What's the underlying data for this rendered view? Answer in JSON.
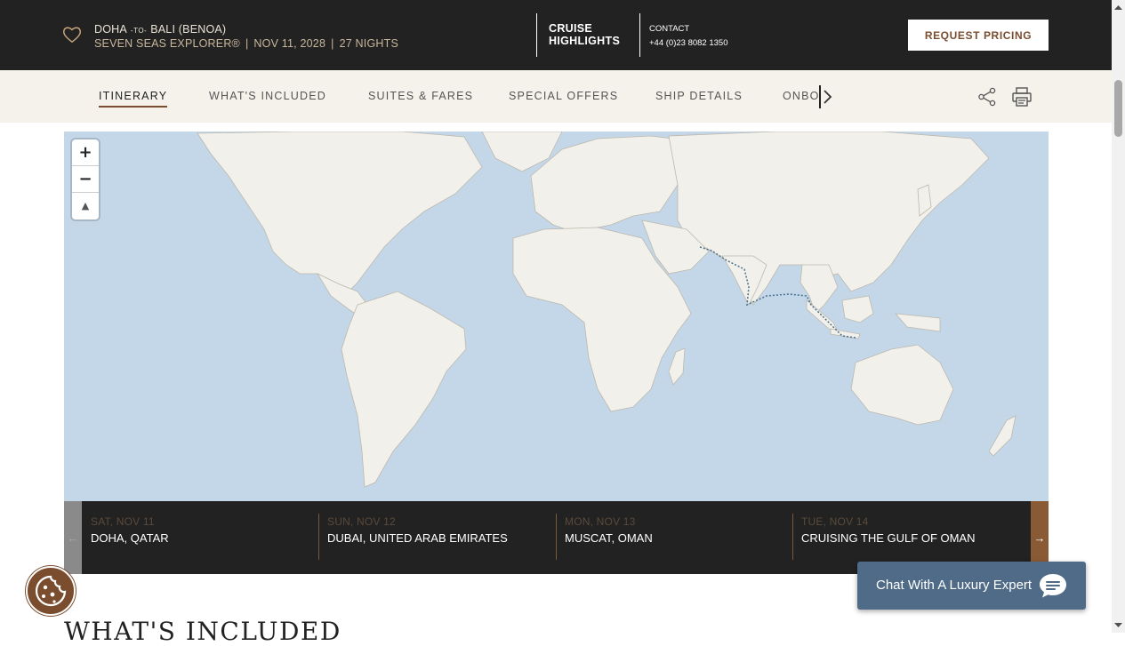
{
  "header": {
    "origin": "DOHA",
    "to_label": "-TO-",
    "destination": "BALI (BENOA)",
    "ship": "SEVEN SEAS EXPLORER®",
    "sep": "|",
    "date": "NOV 11, 2028",
    "nights": "27 NIGHTS",
    "highlights_line1": "CRUISE",
    "highlights_line2": "HIGHLIGHTS",
    "contact_label": "CONTACT",
    "contact_phone": "+44 (0)23 8082 1350",
    "request_pricing": "REQUEST PRICING"
  },
  "tabs": {
    "items": [
      "ITINERARY",
      "WHAT'S INCLUDED",
      "SUITES & FARES",
      "SPECIAL OFFERS",
      "SHIP DETAILS"
    ],
    "clipped": "ONBOARD",
    "active": "ITINERARY"
  },
  "map": {
    "zoom_in": "+",
    "zoom_out": "−",
    "compass": "▲"
  },
  "ports": [
    {
      "date": "SAT, NOV 11",
      "place": "DOHA, QATAR"
    },
    {
      "date": "SUN, NOV 12",
      "place": "DUBAI, UNITED ARAB EMIRATES"
    },
    {
      "date": "MON, NOV 13",
      "place": "MUSCAT, OMAN"
    },
    {
      "date": "TUE, NOV 14",
      "place": "CRUISING THE GULF OF OMAN"
    }
  ],
  "ports_nav": {
    "prev": "←",
    "next": "→"
  },
  "section_title": "WHAT'S INCLUDED",
  "chat": {
    "label": "Chat With A Luxury Expert"
  },
  "colors": {
    "accent": "#7a4d2f",
    "header_bg": "#222222",
    "tabs_bg": "#f5f2ec",
    "ocean": "#c3d7e8",
    "land": "#f2f0eb",
    "chat_bg": "#4f6b87"
  },
  "icons": [
    "heart-icon",
    "chevron-right-icon",
    "share-icon",
    "print-icon",
    "cookie-icon",
    "chat-bubble-icon"
  ]
}
